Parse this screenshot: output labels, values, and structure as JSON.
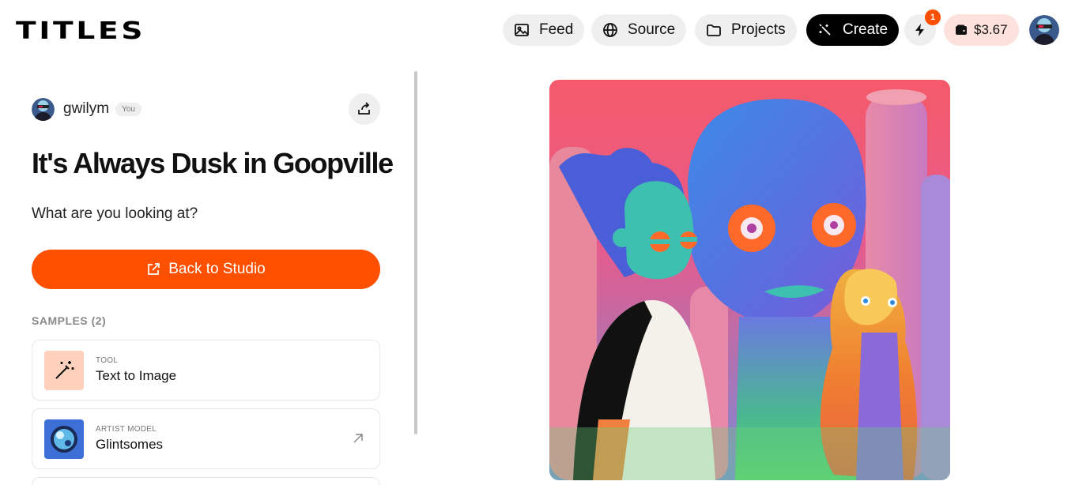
{
  "header": {
    "logo": "TITLES",
    "nav": [
      {
        "label": "Feed",
        "icon": "image-icon"
      },
      {
        "label": "Source",
        "icon": "globe-icon"
      },
      {
        "label": "Projects",
        "icon": "folder-icon"
      },
      {
        "label": "Create",
        "icon": "sparkle-icon"
      }
    ],
    "notifications_count": "1",
    "wallet_balance": "$3.67"
  },
  "project": {
    "author": "gwilym",
    "author_tag": "You",
    "title": "It's Always Dusk in Goopville",
    "description": "What are you looking at?",
    "cta_label": "Back to Studio"
  },
  "samples": {
    "heading": "SAMPLES (2)",
    "items": [
      {
        "kicker": "TOOL",
        "name": "Text to Image",
        "icon": "magic-wand-icon"
      },
      {
        "kicker": "ARTIST MODEL",
        "name": "Glintsomes",
        "icon": "arrow-up-right-icon"
      }
    ]
  },
  "colors": {
    "accent": "#ff5000",
    "create_bg": "#000000",
    "wallet_bg": "#fde1dd",
    "pill_bg": "#efefef"
  }
}
